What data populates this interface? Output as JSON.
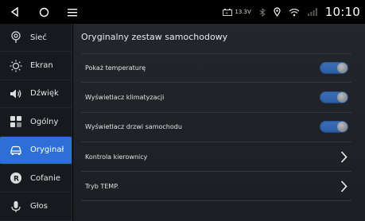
{
  "status_bar": {
    "voltage": "13.3V",
    "time": "10:10"
  },
  "sidebar": {
    "items": [
      {
        "label": "Sieć",
        "icon": "network-icon"
      },
      {
        "label": "Ekran",
        "icon": "brightness-icon"
      },
      {
        "label": "Dźwięk",
        "icon": "speaker-icon"
      },
      {
        "label": "Ogólny",
        "icon": "grid-icon"
      },
      {
        "label": "Oryginał",
        "icon": "car-icon",
        "active": true
      },
      {
        "label": "Cofanie",
        "icon": "reverse-icon"
      },
      {
        "label": "Głos",
        "icon": "microphone-icon"
      }
    ]
  },
  "main": {
    "title": "Oryginalny zestaw samochodowy",
    "rows": [
      {
        "label": "Pokaż temperaturę",
        "control": "toggle",
        "on": true
      },
      {
        "label": "Wyświetlacz klimatyzacji",
        "control": "toggle",
        "on": true
      },
      {
        "label": "Wyświetlacz drzwi samochodu",
        "control": "toggle",
        "on": true
      },
      {
        "label": "Kontrola kierownicy",
        "control": "chevron"
      },
      {
        "label": "Tryb TEMP.",
        "control": "chevron"
      }
    ]
  },
  "colors": {
    "accent": "#2d6fd6",
    "toggle_on": "#3d6fb8",
    "sidebar_bg": "#16191d",
    "main_bg": "#23272c"
  }
}
